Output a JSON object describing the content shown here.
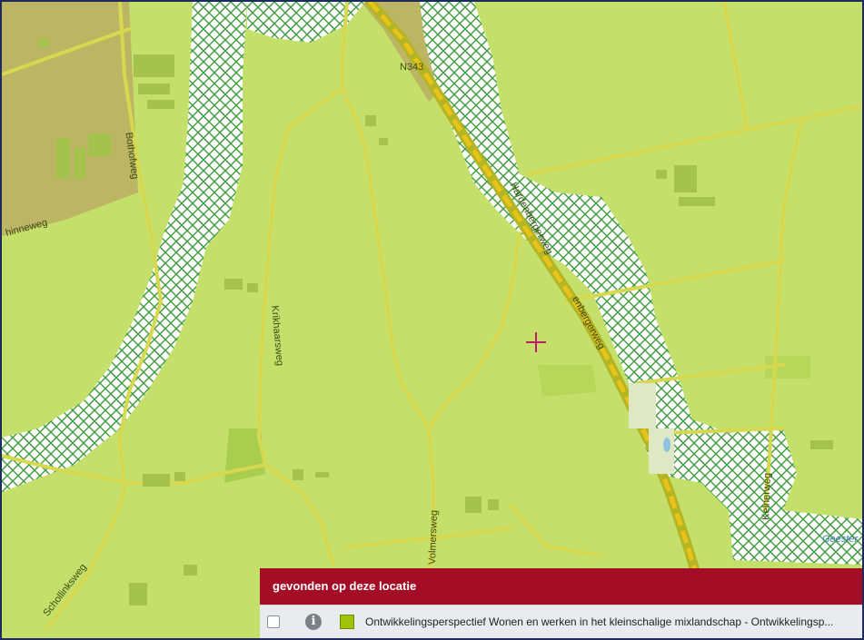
{
  "map": {
    "road_labels": {
      "n343": "N343",
      "bothofweg": "Bothofweg",
      "hinneweg": "hinneweg",
      "hardenbergerweg_1": "Hardenbergerweg",
      "hardenbergerweg_2": "enbergerweg",
      "krikhaarsweg": "Krikhaarsweg",
      "volmersweg": "Volmersweg",
      "schollinksweg": "Schollinksweg",
      "kelnerweg": "Kelnerweg",
      "geesteren": "Geester"
    },
    "colors": {
      "land": "#c5e06a",
      "hatch": "#3d9a3a",
      "road": "#d7d84a",
      "highway": "#e9c21a",
      "marker": "#c2186b"
    }
  },
  "panel": {
    "title": "gevonden op deze locatie",
    "row_text": "Ontwikkelingsperspectief Wonen en werken in het kleinschalige mixlandschap - Ontwikkelingsp...",
    "info_glyph": "i"
  }
}
